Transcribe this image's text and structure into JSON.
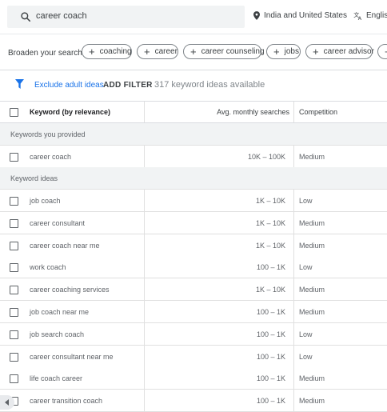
{
  "search": {
    "query": "career coach"
  },
  "location": "India and United States",
  "language": "English",
  "broaden": {
    "label": "Broaden your search:",
    "chips": [
      "coaching",
      "career",
      "career counseling",
      "jobs",
      "career advisor"
    ]
  },
  "filters": {
    "exclude_label": "Exclude adult ideas",
    "add_filter": "ADD FILTER",
    "count": "317 keyword ideas available"
  },
  "table": {
    "headers": {
      "keyword": "Keyword (by relevance)",
      "avg": "Avg. monthly searches",
      "competition": "Competition"
    },
    "provided_label": "Keywords you provided",
    "ideas_label": "Keyword ideas",
    "provided": [
      {
        "keyword": "career coach",
        "avg": "10K – 100K",
        "competition": "Medium"
      }
    ],
    "ideas": [
      {
        "keyword": "job coach",
        "avg": "1K – 10K",
        "competition": "Low"
      },
      {
        "keyword": "career consultant",
        "avg": "1K – 10K",
        "competition": "Medium"
      },
      {
        "keyword": "career coach near me",
        "avg": "1K – 10K",
        "competition": "Medium"
      },
      {
        "keyword": "work coach",
        "avg": "100 – 1K",
        "competition": "Low"
      },
      {
        "keyword": "career coaching services",
        "avg": "1K – 10K",
        "competition": "Medium"
      },
      {
        "keyword": "job coach near me",
        "avg": "100 – 1K",
        "competition": "Medium"
      },
      {
        "keyword": "job search coach",
        "avg": "100 – 1K",
        "competition": "Low"
      },
      {
        "keyword": "career consultant near me",
        "avg": "100 – 1K",
        "competition": "Low"
      },
      {
        "keyword": "life coach career",
        "avg": "100 – 1K",
        "competition": "Medium"
      },
      {
        "keyword": "career transition coach",
        "avg": "100 – 1K",
        "competition": "Medium"
      }
    ]
  },
  "colors": {
    "accent": "#1a73e8",
    "section_bg": "#f1f3f4"
  }
}
